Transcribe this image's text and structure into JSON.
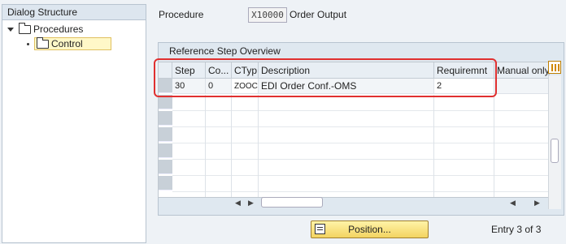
{
  "dialog_structure": {
    "title": "Dialog Structure",
    "items": [
      {
        "label": "Procedures",
        "icon": "folder-icon",
        "expanded": true
      },
      {
        "label": "Control",
        "icon": "folder-open-icon",
        "selected": true
      }
    ]
  },
  "header": {
    "procedure_label": "Procedure",
    "procedure_code": "X10000",
    "procedure_desc": "Order Output"
  },
  "overview": {
    "title": "Reference Step Overview",
    "columns": [
      "Step",
      "Co...",
      "CTyp",
      "Description",
      "Requiremnt",
      "Manual only"
    ],
    "rows": [
      {
        "step": "30",
        "counter": "0",
        "ctyp": "ZOOC",
        "description": "EDI Order Conf.-OMS",
        "requirement": "2",
        "manual": ""
      }
    ]
  },
  "footer": {
    "position_button": "Position...",
    "entry_text": "Entry 3 of 3"
  },
  "colors": {
    "highlight": "#e03030",
    "selected_node": "#fff8c8"
  }
}
